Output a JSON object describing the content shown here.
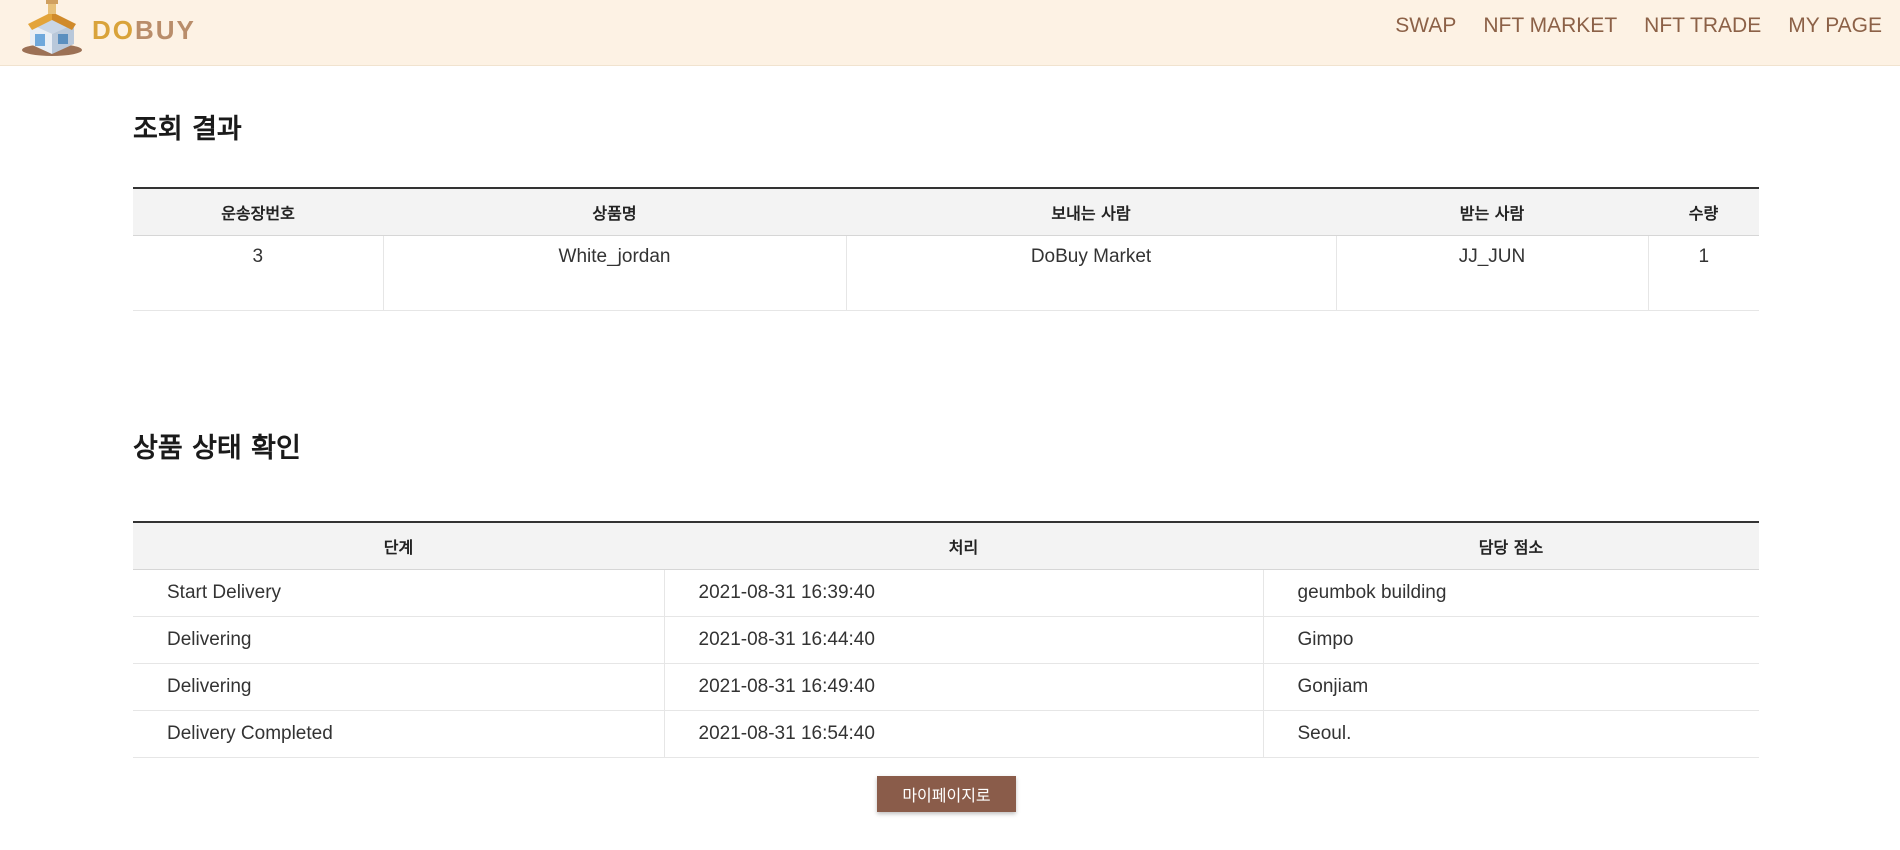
{
  "brand": {
    "logo_do": "DO",
    "logo_buy": "BUY"
  },
  "nav": {
    "items": [
      "SWAP",
      "NFT MARKET",
      "NFT TRADE",
      "MY PAGE"
    ]
  },
  "lookup": {
    "title": "조회 결과",
    "headers": [
      "운송장번호",
      "상품명",
      "보내는 사람",
      "받는 사람",
      "수량"
    ],
    "row": [
      "3",
      "White_jordan",
      "DoBuy Market",
      "JJ_JUN",
      "1"
    ]
  },
  "status": {
    "title": "상품 상태 확인",
    "headers": [
      "단계",
      "처리",
      "담당 점소"
    ],
    "rows": [
      [
        "Start Delivery",
        "2021-08-31 16:39:40",
        "geumbok building"
      ],
      [
        "Delivering",
        "2021-08-31 16:44:40",
        "Gimpo"
      ],
      [
        "Delivering",
        "2021-08-31 16:49:40",
        "Gonjiam"
      ],
      [
        "Delivery Completed",
        "2021-08-31 16:54:40",
        "Seoul."
      ]
    ]
  },
  "button": {
    "mypage_label": "마이페이지로"
  },
  "colors": {
    "nav_bg": "#fdf2e4",
    "nav_text": "#8c6147",
    "button_bg": "#8a5c4a",
    "header_bg": "#f3f3f3"
  }
}
